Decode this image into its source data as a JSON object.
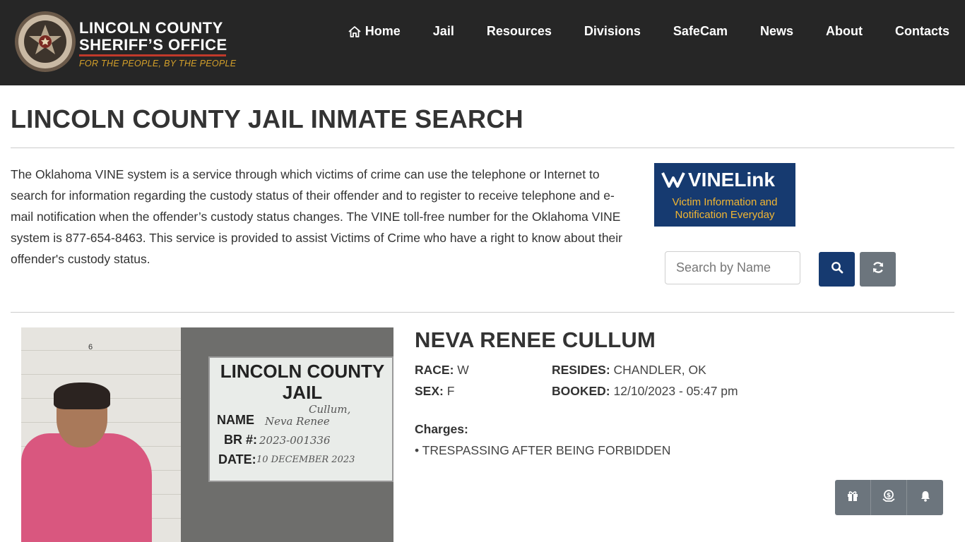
{
  "header": {
    "logo_line1": "LINCOLN COUNTY",
    "logo_line2": "SHERIFF’S OFFICE",
    "logo_tagline": "FOR THE PEOPLE, BY THE PEOPLE",
    "nav": [
      {
        "label": "Home",
        "icon": "home-icon"
      },
      {
        "label": "Jail"
      },
      {
        "label": "Resources"
      },
      {
        "label": "Divisions"
      },
      {
        "label": "SafeCam"
      },
      {
        "label": "News"
      },
      {
        "label": "About"
      },
      {
        "label": "Contacts"
      }
    ]
  },
  "page": {
    "title": "LINCOLN COUNTY JAIL INMATE SEARCH",
    "intro": "The Oklahoma VINE system is a service through which victims of crime can use the telephone or Internet to search for information regarding the custody status of their offender and to register to receive telephone and e-mail notification when the offender’s custody status changes. The VINE toll-free number for the Oklahoma VINE system is 877-654-8463. This service is provided to assist Victims of Crime who have a right to know about their offender's custody status."
  },
  "vine": {
    "logo": "VINELink",
    "subtitle_line1": "Victim Information and",
    "subtitle_line2": "Notification Everyday"
  },
  "search": {
    "placeholder": "Search by Name",
    "value": "",
    "search_icon": "search-icon",
    "refresh_icon": "refresh-icon"
  },
  "inmate": {
    "name": "NEVA RENEE CULLUM",
    "race_label": "RACE:",
    "race": "W",
    "sex_label": "SEX:",
    "sex": "F",
    "resides_label": "RESIDES:",
    "resides": "CHANDLER, OK",
    "booked_label": "BOOKED:",
    "booked": "12/10/2023 - 05:47 pm",
    "charges_label": "Charges:",
    "charges": [
      "• TRESPASSING AFTER BEING FORBIDDEN"
    ]
  },
  "mugshot_board": {
    "line1": "LINCOLN COUNTY",
    "line2": "JAIL",
    "name_label": "NAME",
    "name_hand1": "Cullum,",
    "name_hand2": "Neva Renee",
    "br_label": "BR #:",
    "br_hand": "2023-001336",
    "date_label": "DATE:",
    "date_hand": "10 DECEMBER 2023",
    "height_tick": "6"
  },
  "actions": {
    "icons": [
      "gift-icon",
      "money-icon",
      "bell-icon"
    ]
  },
  "colors": {
    "header_bg": "#262626",
    "primary": "#163a70",
    "secondary": "#6c757d",
    "accent_red": "#c0392b",
    "tagline_gold": "#d4a02a",
    "vine_gold": "#f2b632"
  }
}
